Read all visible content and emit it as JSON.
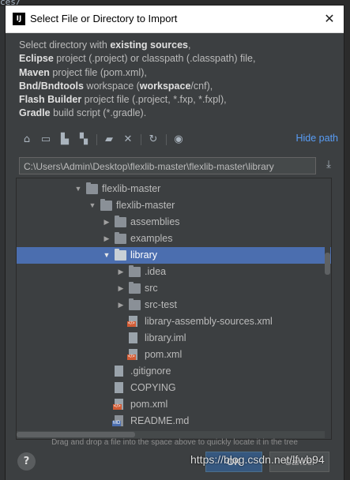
{
  "background": {
    "editor_text": "ces/"
  },
  "window": {
    "title": "Select File or Directory to Import",
    "close_glyph": "✕"
  },
  "description": [
    {
      "bold": "",
      "text": "Select directory with ",
      "bold2": "existing sources",
      "tail": ","
    },
    {
      "bold": "Eclipse",
      "text": " project (.project) or classpath (.classpath) file,",
      "bold2": "",
      "tail": ""
    },
    {
      "bold": "Maven",
      "text": " project file (pom.xml),",
      "bold2": "",
      "tail": ""
    },
    {
      "bold": "Bnd/Bndtools",
      "text": " workspace (",
      "bold2": "workspace",
      "tail": "/cnf),"
    },
    {
      "bold": "Flash Builder",
      "text": " project file (.project, *.fxp, *.fxpl),",
      "bold2": "",
      "tail": ""
    },
    {
      "bold": "Gradle",
      "text": " build script (*.gradle).",
      "bold2": "",
      "tail": ""
    }
  ],
  "toolbar": {
    "icons": [
      "home-icon",
      "desktop-icon",
      "project-icon",
      "module-icon",
      "new-folder-icon",
      "delete-icon",
      "refresh-icon",
      "show-hidden-icon"
    ],
    "hide_path": "Hide path"
  },
  "path": {
    "value": "C:\\Users\\Admin\\Desktop\\flexlib-master\\flexlib-master\\library"
  },
  "tree": [
    {
      "label": "flexlib-master",
      "kind": "folder",
      "depth": 0,
      "arrow": "open"
    },
    {
      "label": "flexlib-master",
      "kind": "folder",
      "depth": 1,
      "arrow": "open"
    },
    {
      "label": "assemblies",
      "kind": "folder",
      "depth": 2,
      "arrow": "closed"
    },
    {
      "label": "examples",
      "kind": "folder",
      "depth": 2,
      "arrow": "closed"
    },
    {
      "label": "library",
      "kind": "folder",
      "depth": 2,
      "arrow": "open",
      "selected": true
    },
    {
      "label": ".idea",
      "kind": "folder",
      "depth": 3,
      "arrow": "closed"
    },
    {
      "label": "src",
      "kind": "folder",
      "depth": 3,
      "arrow": "closed"
    },
    {
      "label": "src-test",
      "kind": "folder",
      "depth": 3,
      "arrow": "closed"
    },
    {
      "label": "library-assembly-sources.xml",
      "kind": "xml",
      "depth": 3,
      "arrow": ""
    },
    {
      "label": "library.iml",
      "kind": "file",
      "depth": 3,
      "arrow": ""
    },
    {
      "label": "pom.xml",
      "kind": "xml",
      "depth": 3,
      "arrow": ""
    },
    {
      "label": ".gitignore",
      "kind": "file",
      "depth": 2,
      "arrow": ""
    },
    {
      "label": "COPYING",
      "kind": "file",
      "depth": 2,
      "arrow": ""
    },
    {
      "label": "pom.xml",
      "kind": "xml",
      "depth": 2,
      "arrow": ""
    },
    {
      "label": "README.md",
      "kind": "md",
      "depth": 2,
      "arrow": ""
    }
  ],
  "hint": "Drag and drop a file into the space above to quickly locate it in the tree",
  "buttons": {
    "help": "?",
    "ok": "OK",
    "cancel": "Cancel"
  },
  "watermark": "https://blog.csdn.net/lfwb94"
}
